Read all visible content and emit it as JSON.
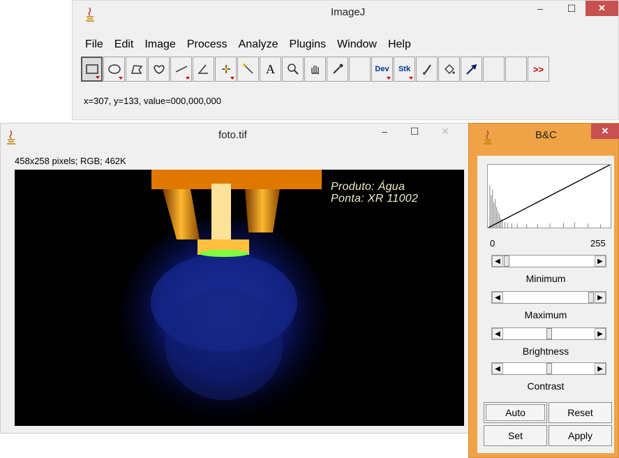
{
  "imagej": {
    "title": "ImageJ",
    "menus": [
      "File",
      "Edit",
      "Image",
      "Process",
      "Analyze",
      "Plugins",
      "Window",
      "Help"
    ],
    "tools": {
      "text_tool": "A",
      "dev": "Dev",
      "stk": "Stk",
      "more": ">>"
    },
    "status": "x=307, y=133, value=000,000,000",
    "minimize": "–",
    "maximize": "☐",
    "close": "✕"
  },
  "image_window": {
    "title": "foto.tif",
    "info": "458x258 pixels; RGB; 462K",
    "overlay_line1": "Produto: Água",
    "overlay_line2": "Ponta: XR 11002",
    "minimize": "–",
    "maximize": "☐",
    "close": "✕"
  },
  "bc": {
    "title": "B&C",
    "close": "✕",
    "range_min": "0",
    "range_max": "255",
    "minimum_label": "Minimum",
    "maximum_label": "Maximum",
    "brightness_label": "Brightness",
    "contrast_label": "Contrast",
    "minimum_value": 0.0,
    "maximum_value": 1.0,
    "brightness_value": 0.5,
    "contrast_value": 0.5,
    "buttons": {
      "auto": "Auto",
      "reset": "Reset",
      "set": "Set",
      "apply": "Apply"
    }
  },
  "colors": {
    "bc_frame": "#f0a346",
    "close_red": "#c75050",
    "overlay_text": "#f3f0c8"
  }
}
